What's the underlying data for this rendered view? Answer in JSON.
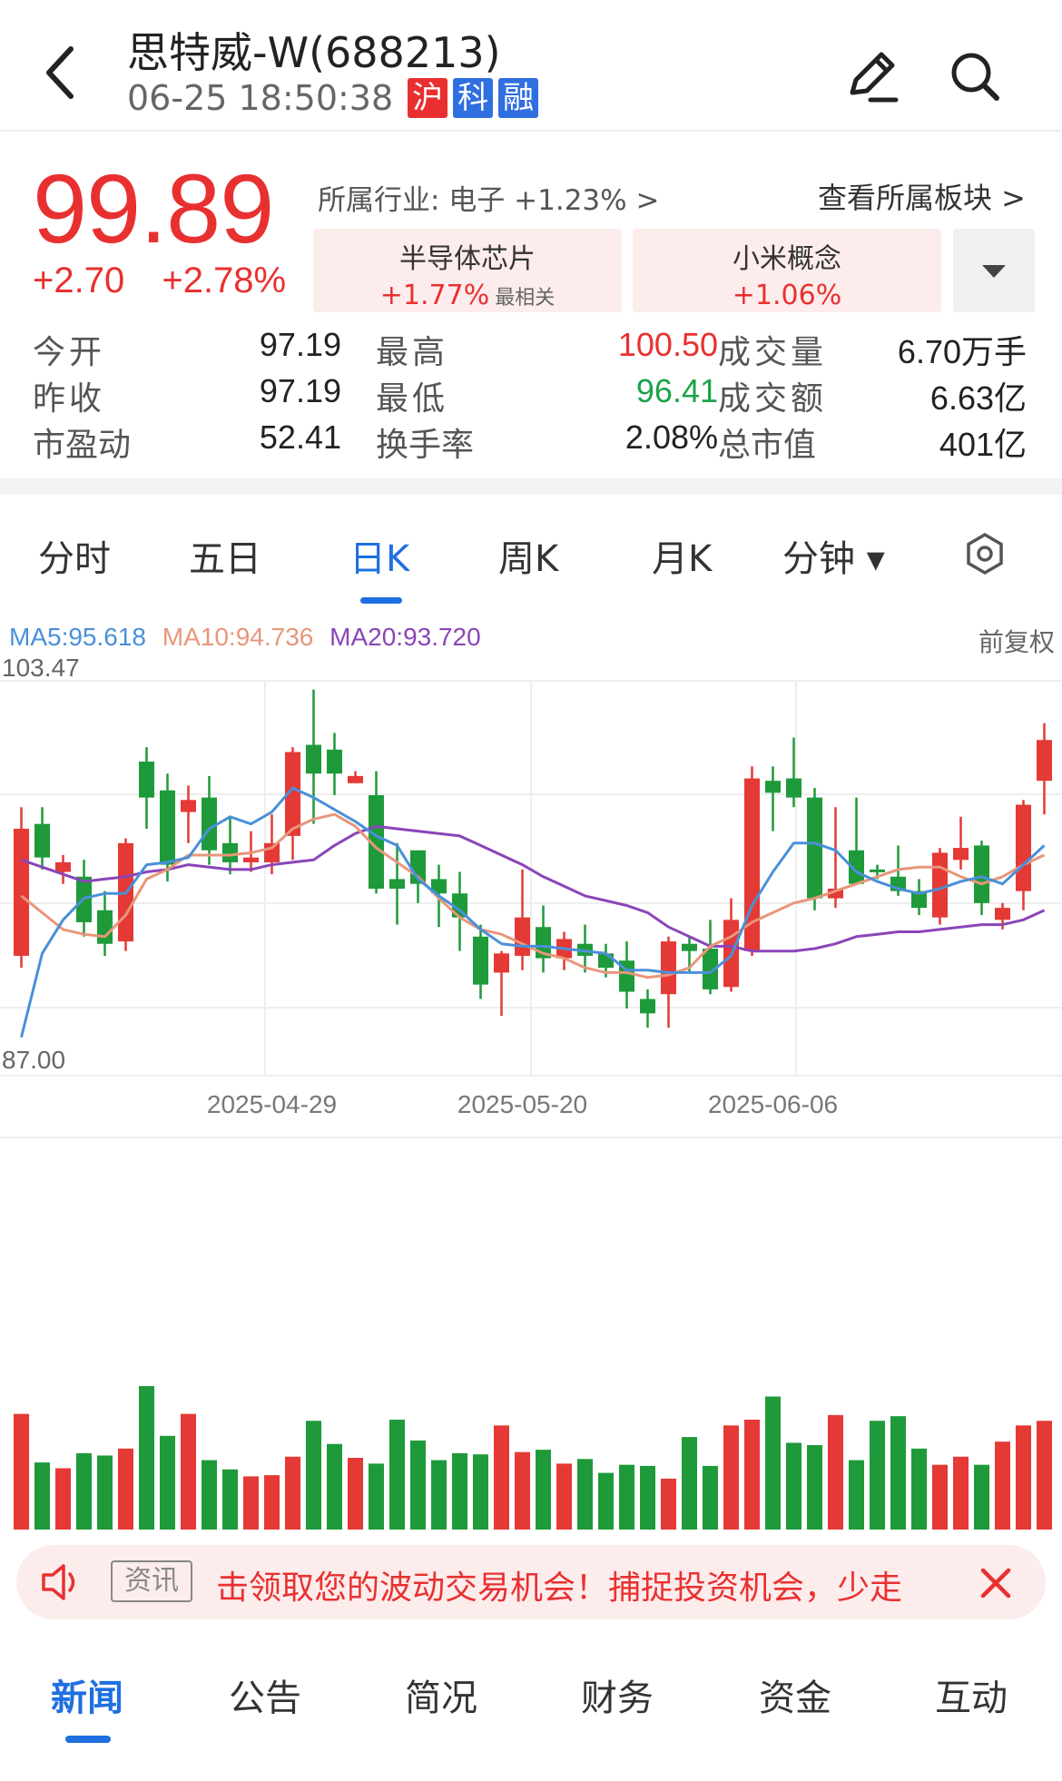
{
  "header": {
    "title": "思特威-W(688213)",
    "datetime": "06-25 18:50:38",
    "badges": [
      {
        "label": "沪",
        "color": "#e93030"
      },
      {
        "label": "科",
        "color": "#2f6fe0"
      },
      {
        "label": "融",
        "color": "#2f6fe0"
      }
    ]
  },
  "quote": {
    "price": "99.89",
    "change": "+2.70",
    "change_pct": "+2.78%",
    "industry": "所属行业: 电子 +1.23% >",
    "view_sector": "查看所属板块 >",
    "chips": [
      {
        "name": "半导体芯片",
        "change": "+1.77%",
        "tag": "最相关"
      },
      {
        "name": "小米概念",
        "change": "+1.06%",
        "tag": ""
      }
    ]
  },
  "stats": [
    [
      {
        "label": "今开",
        "value": "97.19",
        "color": "#222"
      },
      {
        "label": "最高",
        "value": "100.50",
        "color": "#e93030"
      },
      {
        "label": "成交量",
        "value": "6.70万手",
        "color": "#222"
      }
    ],
    [
      {
        "label": "昨收",
        "value": "97.19",
        "color": "#222"
      },
      {
        "label": "最低",
        "value": "96.41",
        "color": "#1aa34a"
      },
      {
        "label": "成交额",
        "value": "6.63亿",
        "color": "#222"
      }
    ],
    [
      {
        "label": "市盈动",
        "value": "52.41",
        "color": "#222"
      },
      {
        "label": "换手率",
        "value": "2.08%",
        "color": "#222"
      },
      {
        "label": "总市值",
        "value": "401亿",
        "color": "#222"
      }
    ]
  ],
  "tabs": [
    {
      "label": "分时",
      "active": false
    },
    {
      "label": "五日",
      "active": false
    },
    {
      "label": "日K",
      "active": true
    },
    {
      "label": "周K",
      "active": false
    },
    {
      "label": "月K",
      "active": false
    },
    {
      "label": "分钟 ▾",
      "active": false
    }
  ],
  "ma": {
    "ma5": "MA5:95.618",
    "ma10": "MA10:94.736",
    "ma20": "MA20:93.720",
    "ma5_color": "#4a90d9",
    "ma10_color": "#e8967a",
    "ma20_color": "#8a45b8",
    "adjust": "前复权"
  },
  "chart_data": {
    "type": "candlestick",
    "ylim": [
      87.0,
      103.47
    ],
    "y_max_label": "103.47",
    "y_min_label": "87.00",
    "x_tick_labels": [
      {
        "label": "2025-04-29",
        "index": 12
      },
      {
        "label": "2025-05-20",
        "index": 24
      },
      {
        "label": "2025-06-06",
        "index": 36
      }
    ],
    "up_color": "#e53935",
    "down_color": "#1e9a3a",
    "candles": [
      {
        "o": 92.0,
        "c": 97.3,
        "h": 98.2,
        "l": 91.5
      },
      {
        "o": 97.5,
        "c": 96.1,
        "h": 98.2,
        "l": 95.6
      },
      {
        "o": 95.5,
        "c": 95.9,
        "h": 96.2,
        "l": 95.0
      },
      {
        "o": 95.3,
        "c": 93.4,
        "h": 96.0,
        "l": 92.8
      },
      {
        "o": 93.9,
        "c": 92.5,
        "h": 94.7,
        "l": 92.0
      },
      {
        "o": 92.6,
        "c": 96.7,
        "h": 96.9,
        "l": 92.2
      },
      {
        "o": 100.1,
        "c": 98.6,
        "h": 100.7,
        "l": 97.3
      },
      {
        "o": 98.9,
        "c": 95.8,
        "h": 99.6,
        "l": 95.1
      },
      {
        "o": 98.0,
        "c": 98.5,
        "h": 99.1,
        "l": 96.7
      },
      {
        "o": 98.6,
        "c": 96.4,
        "h": 99.5,
        "l": 95.8
      },
      {
        "o": 96.7,
        "c": 95.9,
        "h": 97.8,
        "l": 95.4
      },
      {
        "o": 95.9,
        "c": 96.1,
        "h": 97.2,
        "l": 95.5
      },
      {
        "o": 95.9,
        "c": 96.7,
        "h": 97.9,
        "l": 95.4
      },
      {
        "o": 97.0,
        "c": 100.5,
        "h": 100.7,
        "l": 96.0
      },
      {
        "o": 100.8,
        "c": 99.6,
        "h": 103.1,
        "l": 97.5
      },
      {
        "o": 100.6,
        "c": 99.6,
        "h": 101.3,
        "l": 98.7
      },
      {
        "o": 99.2,
        "c": 99.5,
        "h": 99.7,
        "l": 99.2
      },
      {
        "o": 98.7,
        "c": 94.8,
        "h": 99.7,
        "l": 94.6
      },
      {
        "o": 95.2,
        "c": 94.8,
        "h": 96.7,
        "l": 93.3
      },
      {
        "o": 96.4,
        "c": 95.0,
        "h": 96.3,
        "l": 94.2
      },
      {
        "o": 95.2,
        "c": 94.6,
        "h": 95.8,
        "l": 93.2
      },
      {
        "o": 94.6,
        "c": 93.6,
        "h": 95.5,
        "l": 92.2
      },
      {
        "o": 92.8,
        "c": 90.8,
        "h": 93.3,
        "l": 90.2
      },
      {
        "o": 91.3,
        "c": 92.1,
        "h": 92.2,
        "l": 89.5
      },
      {
        "o": 92.0,
        "c": 93.6,
        "h": 95.6,
        "l": 91.4
      },
      {
        "o": 93.2,
        "c": 91.9,
        "h": 94.1,
        "l": 91.3
      },
      {
        "o": 91.9,
        "c": 92.7,
        "h": 93.0,
        "l": 91.4
      },
      {
        "o": 92.5,
        "c": 92.0,
        "h": 93.3,
        "l": 91.3
      },
      {
        "o": 92.1,
        "c": 91.5,
        "h": 92.5,
        "l": 91.1
      },
      {
        "o": 91.8,
        "c": 90.5,
        "h": 92.6,
        "l": 89.8
      },
      {
        "o": 90.2,
        "c": 89.6,
        "h": 90.6,
        "l": 89.0
      },
      {
        "o": 90.4,
        "c": 92.6,
        "h": 92.8,
        "l": 89.0
      },
      {
        "o": 92.5,
        "c": 92.2,
        "h": 92.8,
        "l": 91.3
      },
      {
        "o": 92.3,
        "c": 90.6,
        "h": 93.5,
        "l": 90.4
      },
      {
        "o": 90.7,
        "c": 93.5,
        "h": 94.4,
        "l": 90.5
      },
      {
        "o": 92.2,
        "c": 99.4,
        "h": 99.9,
        "l": 92.0
      },
      {
        "o": 99.3,
        "c": 98.8,
        "h": 99.9,
        "l": 97.2
      },
      {
        "o": 99.4,
        "c": 98.6,
        "h": 101.1,
        "l": 98.2
      },
      {
        "o": 98.6,
        "c": 94.4,
        "h": 99.0,
        "l": 93.9
      },
      {
        "o": 94.4,
        "c": 94.8,
        "h": 98.2,
        "l": 94.0
      },
      {
        "o": 96.4,
        "c": 95.0,
        "h": 98.6,
        "l": 95.5
      },
      {
        "o": 95.6,
        "c": 95.5,
        "h": 95.8,
        "l": 95.2
      },
      {
        "o": 95.3,
        "c": 94.7,
        "h": 96.6,
        "l": 94.5
      },
      {
        "o": 94.7,
        "c": 94.0,
        "h": 95.2,
        "l": 93.7
      },
      {
        "o": 93.6,
        "c": 96.3,
        "h": 96.5,
        "l": 93.3
      },
      {
        "o": 96.0,
        "c": 96.5,
        "h": 97.8,
        "l": 95.6
      },
      {
        "o": 96.6,
        "c": 94.2,
        "h": 96.8,
        "l": 93.7
      },
      {
        "o": 93.5,
        "c": 94.0,
        "h": 94.2,
        "l": 93.1
      },
      {
        "o": 94.7,
        "c": 98.3,
        "h": 98.5,
        "l": 93.9
      },
      {
        "o": 99.3,
        "c": 101.0,
        "h": 101.7,
        "l": 97.9
      }
    ],
    "ma5": [
      88.6,
      92.1,
      93.5,
      94.4,
      94.6,
      94.6,
      95.8,
      95.9,
      96.1,
      97.3,
      97.8,
      97.5,
      98.0,
      99.0,
      98.6,
      98.1,
      97.6,
      97.0,
      96.6,
      95.2,
      94.5,
      93.9,
      93.1,
      92.5,
      92.4,
      92.4,
      92.3,
      92.2,
      92.1,
      91.4,
      91.4,
      91.3,
      91.3,
      91.3,
      92.0,
      94.1,
      95.5,
      96.7,
      96.7,
      96.4,
      95.5,
      95.1,
      94.8,
      94.6,
      94.8,
      95.1,
      95.3,
      95.0,
      95.8,
      96.6
    ],
    "ma10": [
      94.5,
      93.8,
      93.1,
      92.9,
      92.8,
      93.7,
      95.2,
      95.6,
      96.2,
      96.2,
      96.2,
      96.3,
      96.5,
      97.3,
      97.7,
      97.9,
      97.4,
      96.5,
      95.9,
      95.3,
      94.4,
      93.6,
      93.1,
      92.9,
      92.5,
      92.1,
      91.9,
      91.5,
      91.3,
      91.3,
      91.1,
      91.2,
      91.5,
      92.4,
      92.8,
      93.4,
      93.8,
      94.2,
      94.4,
      94.7,
      95.0,
      95.3,
      95.6,
      95.7,
      95.7,
      95.3,
      95.0,
      95.3,
      95.8,
      96.2
    ],
    "ma20": [
      96.0,
      95.7,
      95.4,
      95.1,
      95.2,
      95.3,
      95.5,
      95.6,
      95.8,
      95.7,
      95.6,
      95.6,
      95.8,
      95.9,
      96.0,
      96.6,
      97.1,
      97.4,
      97.3,
      97.2,
      97.1,
      97.0,
      96.6,
      96.2,
      95.8,
      95.3,
      94.9,
      94.5,
      94.3,
      94.1,
      93.8,
      93.2,
      92.8,
      92.4,
      92.4,
      92.2,
      92.2,
      92.2,
      92.3,
      92.5,
      92.8,
      92.9,
      93.0,
      93.0,
      93.1,
      93.2,
      93.3,
      93.3,
      93.5,
      93.9
    ],
    "volume": [
      100,
      58,
      53,
      66,
      64,
      70,
      124,
      81,
      100,
      60,
      52,
      46,
      47,
      63,
      94,
      74,
      62,
      57,
      95,
      77,
      60,
      66,
      65,
      90,
      67,
      69,
      57,
      61,
      49,
      56,
      55,
      44,
      80,
      55,
      90,
      95,
      115,
      75,
      73,
      99,
      60,
      94,
      98,
      70,
      56,
      63,
      56,
      76,
      90,
      94
    ]
  },
  "ticker": {
    "tag": "资讯",
    "text": "击领取您的波动交易机会！捕捉投资机会，少走"
  },
  "bottom_tabs": [
    {
      "label": "新闻",
      "active": true
    },
    {
      "label": "公告",
      "active": false
    },
    {
      "label": "简况",
      "active": false
    },
    {
      "label": "财务",
      "active": false
    },
    {
      "label": "资金",
      "active": false
    },
    {
      "label": "互动",
      "active": false
    }
  ]
}
